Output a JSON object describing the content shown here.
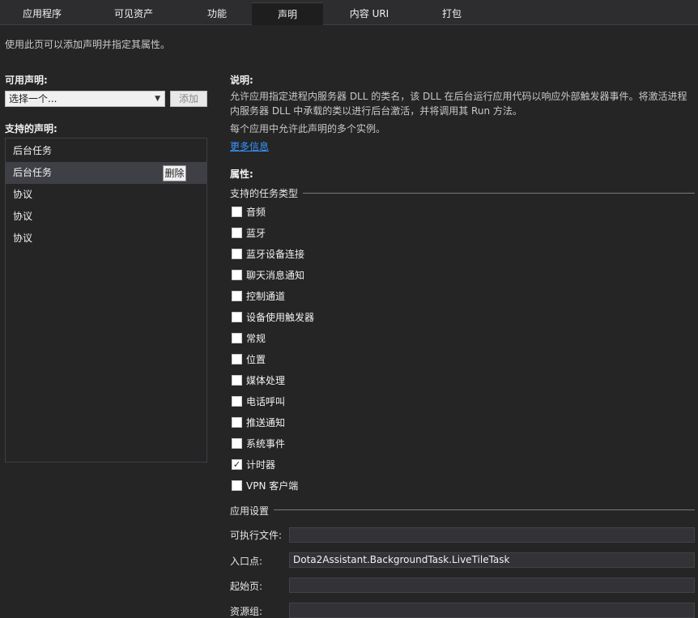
{
  "tabs": [
    "应用程序",
    "可见资产",
    "功能",
    "声明",
    "内容 URI",
    "打包"
  ],
  "active_tab": "声明",
  "intro": "使用此页可以添加声明并指定其属性。",
  "available": {
    "label": "可用声明:",
    "select_value": "选择一个...",
    "add_label": "添加"
  },
  "supported": {
    "label": "支持的声明:",
    "items": [
      "后台任务",
      "后台任务",
      "协议",
      "协议",
      "协议"
    ],
    "delete_label": "删除"
  },
  "description": {
    "label": "说明:",
    "text": "允许应用指定进程内服务器 DLL 的类名，该 DLL 在后台运行应用代码以响应外部触发器事件。将激活进程内服务器 DLL 中承载的类以进行后台激活，并将调用其 Run 方法。",
    "multi": "每个应用中允许此声明的多个实例。",
    "more_info": "更多信息"
  },
  "properties": {
    "label": "属性:",
    "task_types_title": "支持的任务类型",
    "task_types": [
      {
        "label": "音频",
        "checked": false
      },
      {
        "label": "蓝牙",
        "checked": false
      },
      {
        "label": "蓝牙设备连接",
        "checked": false
      },
      {
        "label": "聊天消息通知",
        "checked": false
      },
      {
        "label": "控制通道",
        "checked": false
      },
      {
        "label": "设备使用触发器",
        "checked": false
      },
      {
        "label": "常规",
        "checked": false
      },
      {
        "label": "位置",
        "checked": false
      },
      {
        "label": "媒体处理",
        "checked": false
      },
      {
        "label": "电话呼叫",
        "checked": false
      },
      {
        "label": "推送通知",
        "checked": false
      },
      {
        "label": "系统事件",
        "checked": false
      },
      {
        "label": "计时器",
        "checked": true
      },
      {
        "label": "VPN 客户端",
        "checked": false
      }
    ],
    "app_settings_title": "应用设置",
    "fields": [
      {
        "label": "可执行文件:",
        "value": ""
      },
      {
        "label": "入口点:",
        "value": "Dota2Assistant.BackgroundTask.LiveTileTask"
      },
      {
        "label": "起始页:",
        "value": ""
      },
      {
        "label": "资源组:",
        "value": ""
      }
    ]
  }
}
